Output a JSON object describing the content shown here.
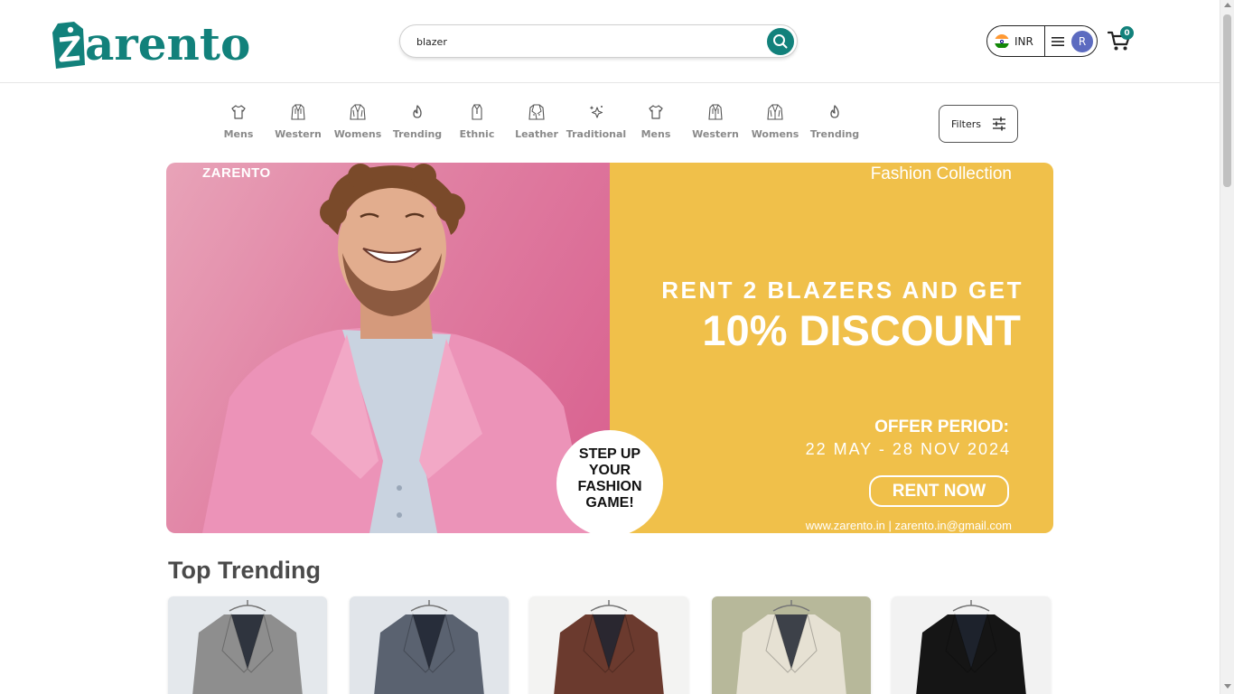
{
  "header": {
    "logo_text": "arento",
    "search": {
      "value": "blazer",
      "placeholder": ""
    },
    "currency": {
      "code": "INR"
    },
    "user_initial": "R",
    "cart_count": "0"
  },
  "categories": [
    {
      "label": "Mens",
      "icon": "tshirt-icon"
    },
    {
      "label": "Western",
      "icon": "jacket-icon"
    },
    {
      "label": "Womens",
      "icon": "coat-icon"
    },
    {
      "label": "Trending",
      "icon": "fire-icon"
    },
    {
      "label": "Ethnic",
      "icon": "kurta-icon"
    },
    {
      "label": "Leather",
      "icon": "leather-jacket-icon"
    },
    {
      "label": "Traditional",
      "icon": "sparkle-icon"
    },
    {
      "label": "Mens",
      "icon": "tshirt-icon"
    },
    {
      "label": "Western",
      "icon": "jacket-icon"
    },
    {
      "label": "Womens",
      "icon": "coat-icon"
    },
    {
      "label": "Trending",
      "icon": "fire-icon"
    }
  ],
  "filters_label": "Filters",
  "banner": {
    "brand": "ZARENTO",
    "collection": "Fashion Collection",
    "headline_line1": "RENT 2 BLAZERS AND GET",
    "headline_line2": "10% DISCOUNT",
    "offer_label": "OFFER PERIOD:",
    "offer_dates": "22 MAY - 28 NOV 2024",
    "cta": "RENT NOW",
    "contact": "www.zarento.in | zarento.in@gmail.com",
    "badge_text": "STEP UP YOUR FASHION GAME!",
    "colors": {
      "left": "#e07fa2",
      "right": "#f0c04a"
    }
  },
  "section": {
    "title": "Top Trending"
  },
  "products": [
    {
      "name": "grey-tweed-blazer",
      "bg": "#e4e8ec",
      "jacket": "#8e8e8e"
    },
    {
      "name": "navy-textured-blazer",
      "bg": "#e1e5ea",
      "jacket": "#5a6270"
    },
    {
      "name": "brown-blazer",
      "bg": "#f3f3f2",
      "jacket": "#6b3a2e"
    },
    {
      "name": "cream-blazer",
      "bg": "#b7b89a",
      "jacket": "#e6e1d3"
    },
    {
      "name": "black-blazer",
      "bg": "#f2f2f2",
      "jacket": "#151515"
    }
  ],
  "colors": {
    "brand": "#12817b",
    "avatar": "#5c6bc0"
  }
}
